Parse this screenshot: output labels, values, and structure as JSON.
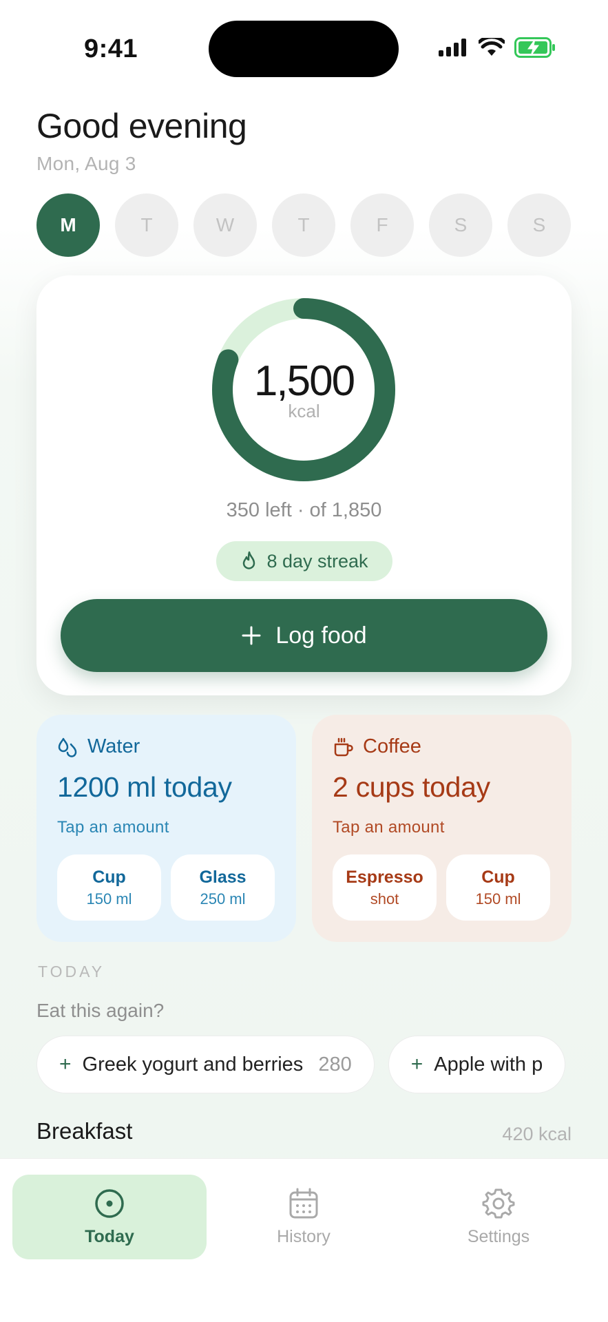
{
  "status_bar": {
    "time": "9:41"
  },
  "header": {
    "greeting": "Good evening",
    "date": "Mon, Aug 3"
  },
  "week": {
    "days": [
      "M",
      "T",
      "W",
      "T",
      "F",
      "S",
      "S"
    ],
    "selected_index": 0
  },
  "summary": {
    "calories_value": "1,500",
    "calories_unit": "kcal",
    "remaining_text": "350 left · of 1,850",
    "progress_fraction": 0.81,
    "streak_label": "8 day streak",
    "log_button_label": "Log food"
  },
  "water": {
    "title": "Water",
    "amount": "1200 ml today",
    "hint": "Tap an amount",
    "options": [
      {
        "name": "Cup",
        "sub": "150 ml"
      },
      {
        "name": "Glass",
        "sub": "250 ml"
      }
    ]
  },
  "coffee": {
    "title": "Coffee",
    "amount": "2 cups today",
    "hint": "Tap an amount",
    "options": [
      {
        "name": "Espresso",
        "sub": "shot"
      },
      {
        "name": "Cup",
        "sub": "150 ml"
      }
    ]
  },
  "today": {
    "section_label": "TODAY",
    "again_label": "Eat this again?",
    "suggestions": [
      {
        "plus": "+",
        "name": "Greek yogurt and berries",
        "kcal": "280"
      },
      {
        "plus": "+",
        "name": "Apple with p",
        "kcal": ""
      }
    ],
    "meal": {
      "title": "Breakfast",
      "kcal": "420 kcal"
    }
  },
  "tab_bar": {
    "tabs": [
      {
        "label": "Today"
      },
      {
        "label": "History"
      },
      {
        "label": "Settings"
      }
    ],
    "active_index": 0
  },
  "colors": {
    "accent": "#2f6b4f",
    "accent_light": "#dbf1dc",
    "water": "#12689a",
    "coffee": "#a63a16"
  },
  "icons": {
    "status": [
      "signal-icon",
      "wifi-icon",
      "battery-charging-icon"
    ],
    "streak": "flame-icon",
    "log": "plus-icon",
    "water": "droplets-icon",
    "coffee": "coffee-cup-icon",
    "tabs": [
      "target-icon",
      "calendar-icon",
      "gear-icon"
    ]
  }
}
